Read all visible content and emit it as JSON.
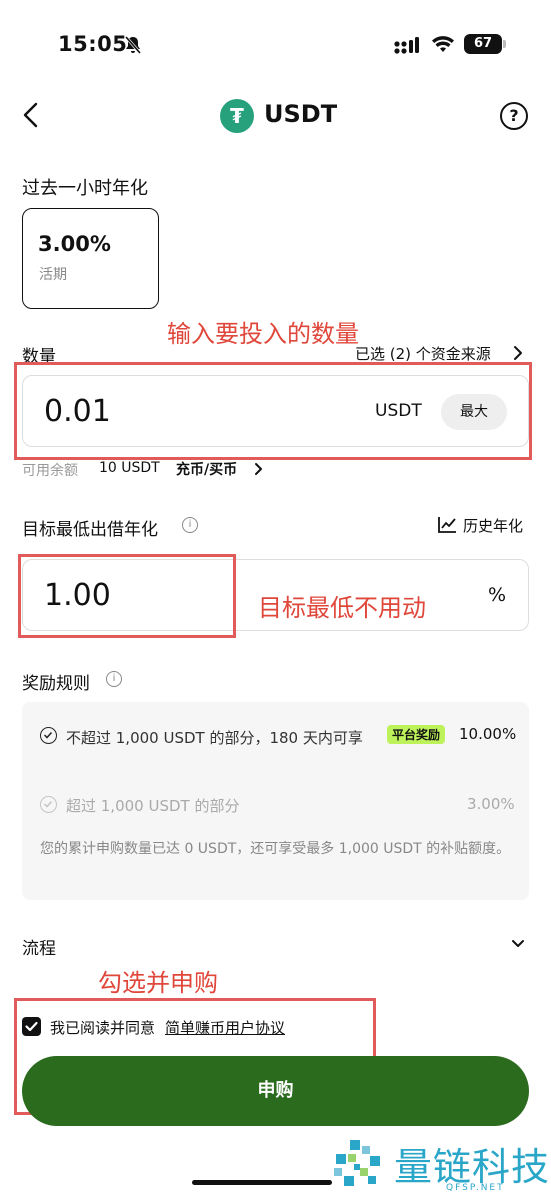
{
  "status_bar": {
    "time": "15:05",
    "battery": "67"
  },
  "nav": {
    "coin_symbol": "₮",
    "title": "USDT",
    "help_glyph": "?"
  },
  "apr": {
    "label": "过去一小时年化",
    "value": "3.00%",
    "sub": "活期"
  },
  "annotations": {
    "a1": "输入要投入的数量",
    "a2": "目标最低不用动",
    "a3": "勾选并申购"
  },
  "quantity": {
    "label": "数量",
    "funding": "已选 (2) 个资金来源",
    "value": "0.01",
    "unit": "USDT",
    "max_label": "最大",
    "balance_label": "可用余额",
    "balance_value": "10 USDT",
    "deposit_link": "充币/买币"
  },
  "target": {
    "label": "目标最低出借年化",
    "info_glyph": "i",
    "history_label": "历史年化",
    "value": "1.00",
    "unit": "%"
  },
  "rules": {
    "label": "奖励规则",
    "info_glyph": "i",
    "tier1_text": "不超过 1,000 USDT 的部分，180 天内可享",
    "tier1_badge": "平台奖励",
    "tier1_rate": "10.00%",
    "tier2_text": "超过 1,000 USDT 的部分",
    "tier2_rate": "3.00%",
    "note": "您的累计申购数量已达 0 USDT，还可享受最多 1,000 USDT 的补贴额度。"
  },
  "flow": {
    "label": "流程"
  },
  "agreement": {
    "prefix": "我已阅读并同意",
    "link": "简单赚币用户协议",
    "checked": true
  },
  "submit": {
    "label": "申购"
  },
  "watermark": {
    "name": "量链科技",
    "domain": "QFSP.NET"
  },
  "colors": {
    "primary_button": "#2b6b1e",
    "annotation_red": "#e0473b",
    "badge_green": "#bdf25a",
    "tether": "#26a17b",
    "watermark": "#2aa6c8"
  }
}
